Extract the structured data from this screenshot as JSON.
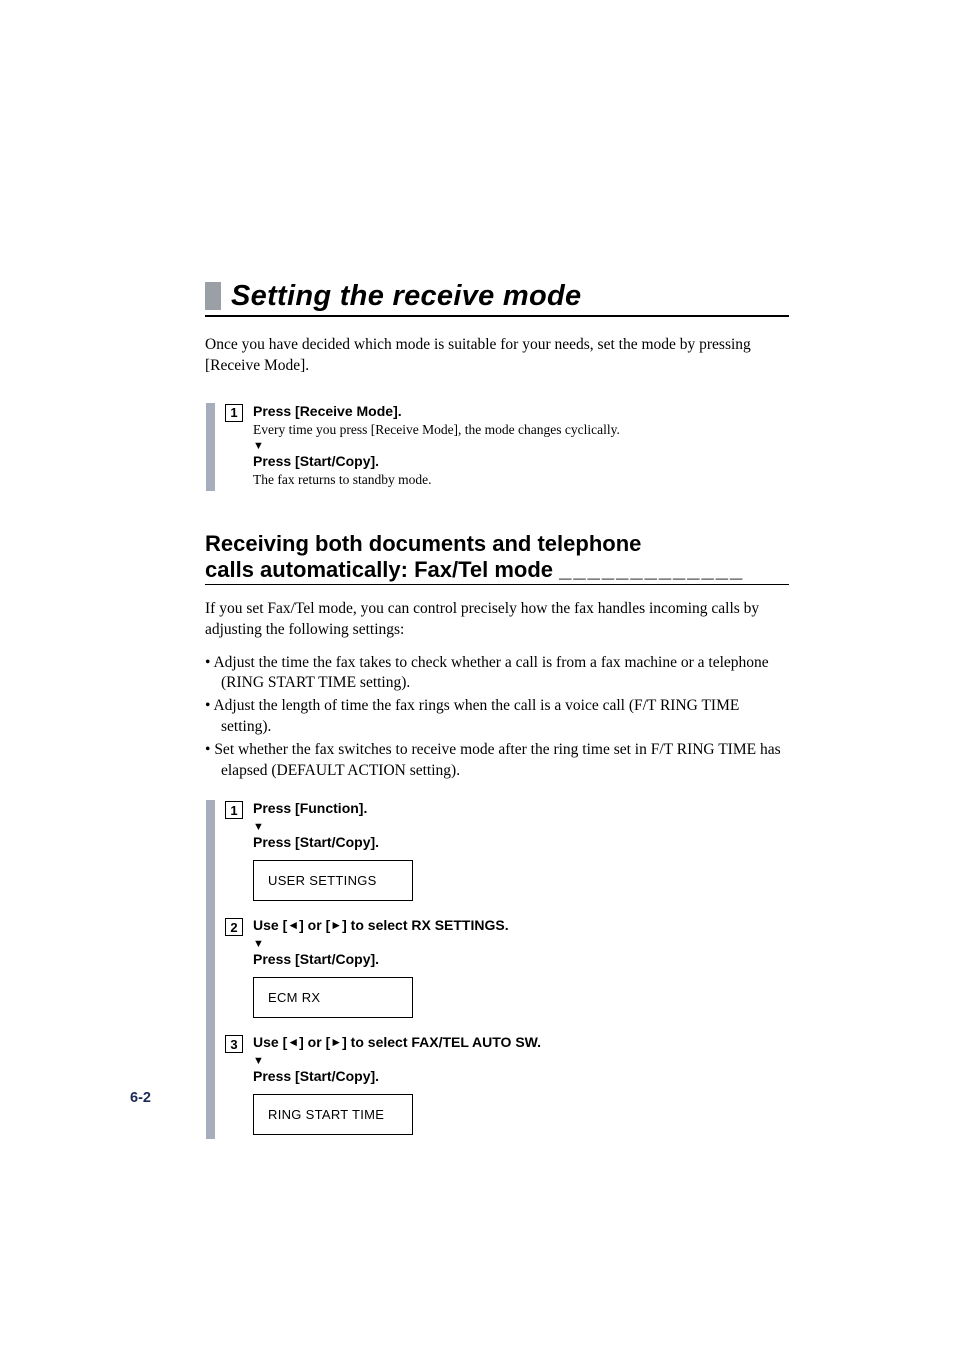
{
  "title": "Setting the receive mode",
  "intro": "Once you have decided which mode is suitable for your needs, set the mode by pressing [Receive Mode].",
  "blockA": {
    "step1": {
      "num": "1",
      "heading": "Press [Receive Mode].",
      "desc": "Every time you press [Receive Mode], the mode changes cyclically.",
      "sub_heading": "Press [Start/Copy].",
      "sub_desc": "The fax returns to standby mode."
    }
  },
  "section": {
    "heading_line1": "Receiving both documents and telephone",
    "heading_line2": "calls automatically: Fax/Tel mode ",
    "heading_fill": "_____________",
    "intro": "If you set Fax/Tel mode, you can control precisely how the fax handles incoming calls by adjusting the following settings:",
    "bullets": [
      "Adjust the time the fax takes to check whether a call is from a fax machine or a telephone (RING START TIME setting).",
      "Adjust the length of time the fax rings when the call is a voice call (F/T RING TIME setting).",
      "Set whether the fax switches to receive mode after the ring time set in F/T RING TIME has elapsed (DEFAULT ACTION setting)."
    ]
  },
  "blockB": {
    "step1": {
      "num": "1",
      "heading": "Press [Function].",
      "sub_heading": "Press [Start/Copy].",
      "display": "USER SETTINGS"
    },
    "step2": {
      "num": "2",
      "heading_prefix": "Use [",
      "heading_mid1": "] or [",
      "heading_mid2": "] to select RX SETTINGS.",
      "sub_heading": "Press [Start/Copy].",
      "display": "ECM RX"
    },
    "step3": {
      "num": "3",
      "heading_prefix": "Use [",
      "heading_mid1": "] or [",
      "heading_mid2": "] to select FAX/TEL AUTO SW.",
      "sub_heading": "Press [Start/Copy].",
      "display": "RING START  TIME"
    }
  },
  "page_number": "6-2"
}
